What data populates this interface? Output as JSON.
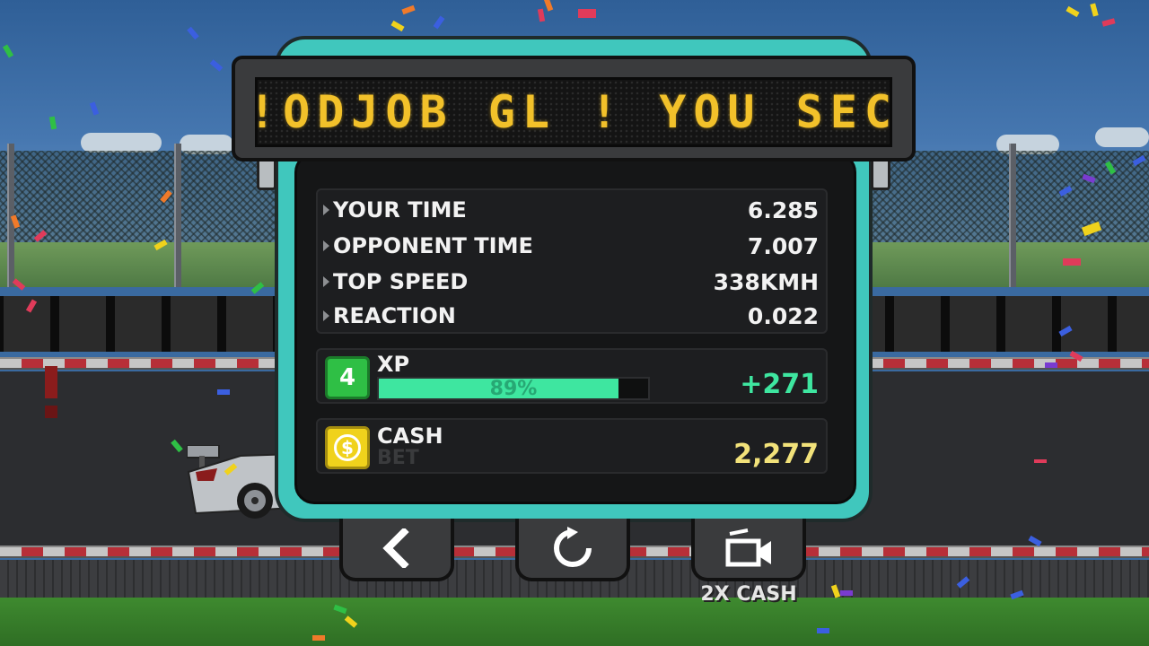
{
  "scoreboard": {
    "ticker_text": "!ODJOB GL ! YOU SEC"
  },
  "stats": {
    "rows": [
      {
        "label": "YOUR TIME",
        "value": "6.285"
      },
      {
        "label": "OPPONENT TIME",
        "value": "7.007"
      },
      {
        "label": "TOP SPEED",
        "value": "338KMH"
      },
      {
        "label": "REACTION",
        "value": "0.022"
      }
    ]
  },
  "xp": {
    "level": "4",
    "label": "XP",
    "progress_percent": 89,
    "progress_text": "89%",
    "gain": "+271",
    "gain_color": "#3ee6a0"
  },
  "cash": {
    "icon": "dollar-coin-icon",
    "symbol": "$",
    "label": "CASH",
    "sub_label": "BET",
    "amount": "2,277",
    "amount_color": "#f2e27a"
  },
  "buttons": {
    "back": {
      "icon": "chevron-left-icon"
    },
    "restart": {
      "icon": "restart-icon"
    },
    "video": {
      "icon": "video-camera-icon",
      "label": "2X CASH"
    }
  },
  "colors": {
    "panel_accent": "#40c7bd",
    "ticker": "#f2c12a"
  }
}
